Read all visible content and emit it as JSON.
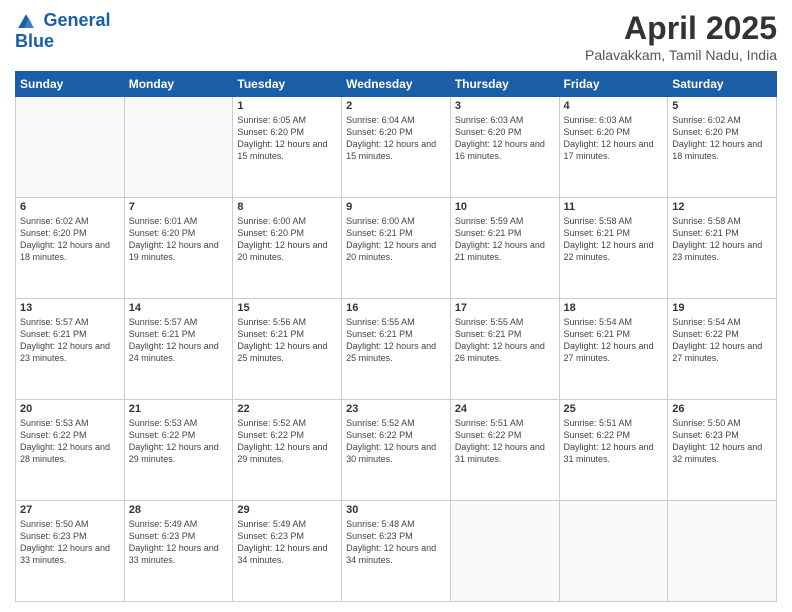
{
  "header": {
    "logo_line1": "General",
    "logo_line2": "Blue",
    "title": "April 2025",
    "subtitle": "Palavakkam, Tamil Nadu, India"
  },
  "weekdays": [
    "Sunday",
    "Monday",
    "Tuesday",
    "Wednesday",
    "Thursday",
    "Friday",
    "Saturday"
  ],
  "weeks": [
    [
      {
        "day": "",
        "text": ""
      },
      {
        "day": "",
        "text": ""
      },
      {
        "day": "1",
        "text": "Sunrise: 6:05 AM\nSunset: 6:20 PM\nDaylight: 12 hours and 15 minutes."
      },
      {
        "day": "2",
        "text": "Sunrise: 6:04 AM\nSunset: 6:20 PM\nDaylight: 12 hours and 15 minutes."
      },
      {
        "day": "3",
        "text": "Sunrise: 6:03 AM\nSunset: 6:20 PM\nDaylight: 12 hours and 16 minutes."
      },
      {
        "day": "4",
        "text": "Sunrise: 6:03 AM\nSunset: 6:20 PM\nDaylight: 12 hours and 17 minutes."
      },
      {
        "day": "5",
        "text": "Sunrise: 6:02 AM\nSunset: 6:20 PM\nDaylight: 12 hours and 18 minutes."
      }
    ],
    [
      {
        "day": "6",
        "text": "Sunrise: 6:02 AM\nSunset: 6:20 PM\nDaylight: 12 hours and 18 minutes."
      },
      {
        "day": "7",
        "text": "Sunrise: 6:01 AM\nSunset: 6:20 PM\nDaylight: 12 hours and 19 minutes."
      },
      {
        "day": "8",
        "text": "Sunrise: 6:00 AM\nSunset: 6:20 PM\nDaylight: 12 hours and 20 minutes."
      },
      {
        "day": "9",
        "text": "Sunrise: 6:00 AM\nSunset: 6:21 PM\nDaylight: 12 hours and 20 minutes."
      },
      {
        "day": "10",
        "text": "Sunrise: 5:59 AM\nSunset: 6:21 PM\nDaylight: 12 hours and 21 minutes."
      },
      {
        "day": "11",
        "text": "Sunrise: 5:58 AM\nSunset: 6:21 PM\nDaylight: 12 hours and 22 minutes."
      },
      {
        "day": "12",
        "text": "Sunrise: 5:58 AM\nSunset: 6:21 PM\nDaylight: 12 hours and 23 minutes."
      }
    ],
    [
      {
        "day": "13",
        "text": "Sunrise: 5:57 AM\nSunset: 6:21 PM\nDaylight: 12 hours and 23 minutes."
      },
      {
        "day": "14",
        "text": "Sunrise: 5:57 AM\nSunset: 6:21 PM\nDaylight: 12 hours and 24 minutes."
      },
      {
        "day": "15",
        "text": "Sunrise: 5:56 AM\nSunset: 6:21 PM\nDaylight: 12 hours and 25 minutes."
      },
      {
        "day": "16",
        "text": "Sunrise: 5:55 AM\nSunset: 6:21 PM\nDaylight: 12 hours and 25 minutes."
      },
      {
        "day": "17",
        "text": "Sunrise: 5:55 AM\nSunset: 6:21 PM\nDaylight: 12 hours and 26 minutes."
      },
      {
        "day": "18",
        "text": "Sunrise: 5:54 AM\nSunset: 6:21 PM\nDaylight: 12 hours and 27 minutes."
      },
      {
        "day": "19",
        "text": "Sunrise: 5:54 AM\nSunset: 6:22 PM\nDaylight: 12 hours and 27 minutes."
      }
    ],
    [
      {
        "day": "20",
        "text": "Sunrise: 5:53 AM\nSunset: 6:22 PM\nDaylight: 12 hours and 28 minutes."
      },
      {
        "day": "21",
        "text": "Sunrise: 5:53 AM\nSunset: 6:22 PM\nDaylight: 12 hours and 29 minutes."
      },
      {
        "day": "22",
        "text": "Sunrise: 5:52 AM\nSunset: 6:22 PM\nDaylight: 12 hours and 29 minutes."
      },
      {
        "day": "23",
        "text": "Sunrise: 5:52 AM\nSunset: 6:22 PM\nDaylight: 12 hours and 30 minutes."
      },
      {
        "day": "24",
        "text": "Sunrise: 5:51 AM\nSunset: 6:22 PM\nDaylight: 12 hours and 31 minutes."
      },
      {
        "day": "25",
        "text": "Sunrise: 5:51 AM\nSunset: 6:22 PM\nDaylight: 12 hours and 31 minutes."
      },
      {
        "day": "26",
        "text": "Sunrise: 5:50 AM\nSunset: 6:23 PM\nDaylight: 12 hours and 32 minutes."
      }
    ],
    [
      {
        "day": "27",
        "text": "Sunrise: 5:50 AM\nSunset: 6:23 PM\nDaylight: 12 hours and 33 minutes."
      },
      {
        "day": "28",
        "text": "Sunrise: 5:49 AM\nSunset: 6:23 PM\nDaylight: 12 hours and 33 minutes."
      },
      {
        "day": "29",
        "text": "Sunrise: 5:49 AM\nSunset: 6:23 PM\nDaylight: 12 hours and 34 minutes."
      },
      {
        "day": "30",
        "text": "Sunrise: 5:48 AM\nSunset: 6:23 PM\nDaylight: 12 hours and 34 minutes."
      },
      {
        "day": "",
        "text": ""
      },
      {
        "day": "",
        "text": ""
      },
      {
        "day": "",
        "text": ""
      }
    ]
  ]
}
